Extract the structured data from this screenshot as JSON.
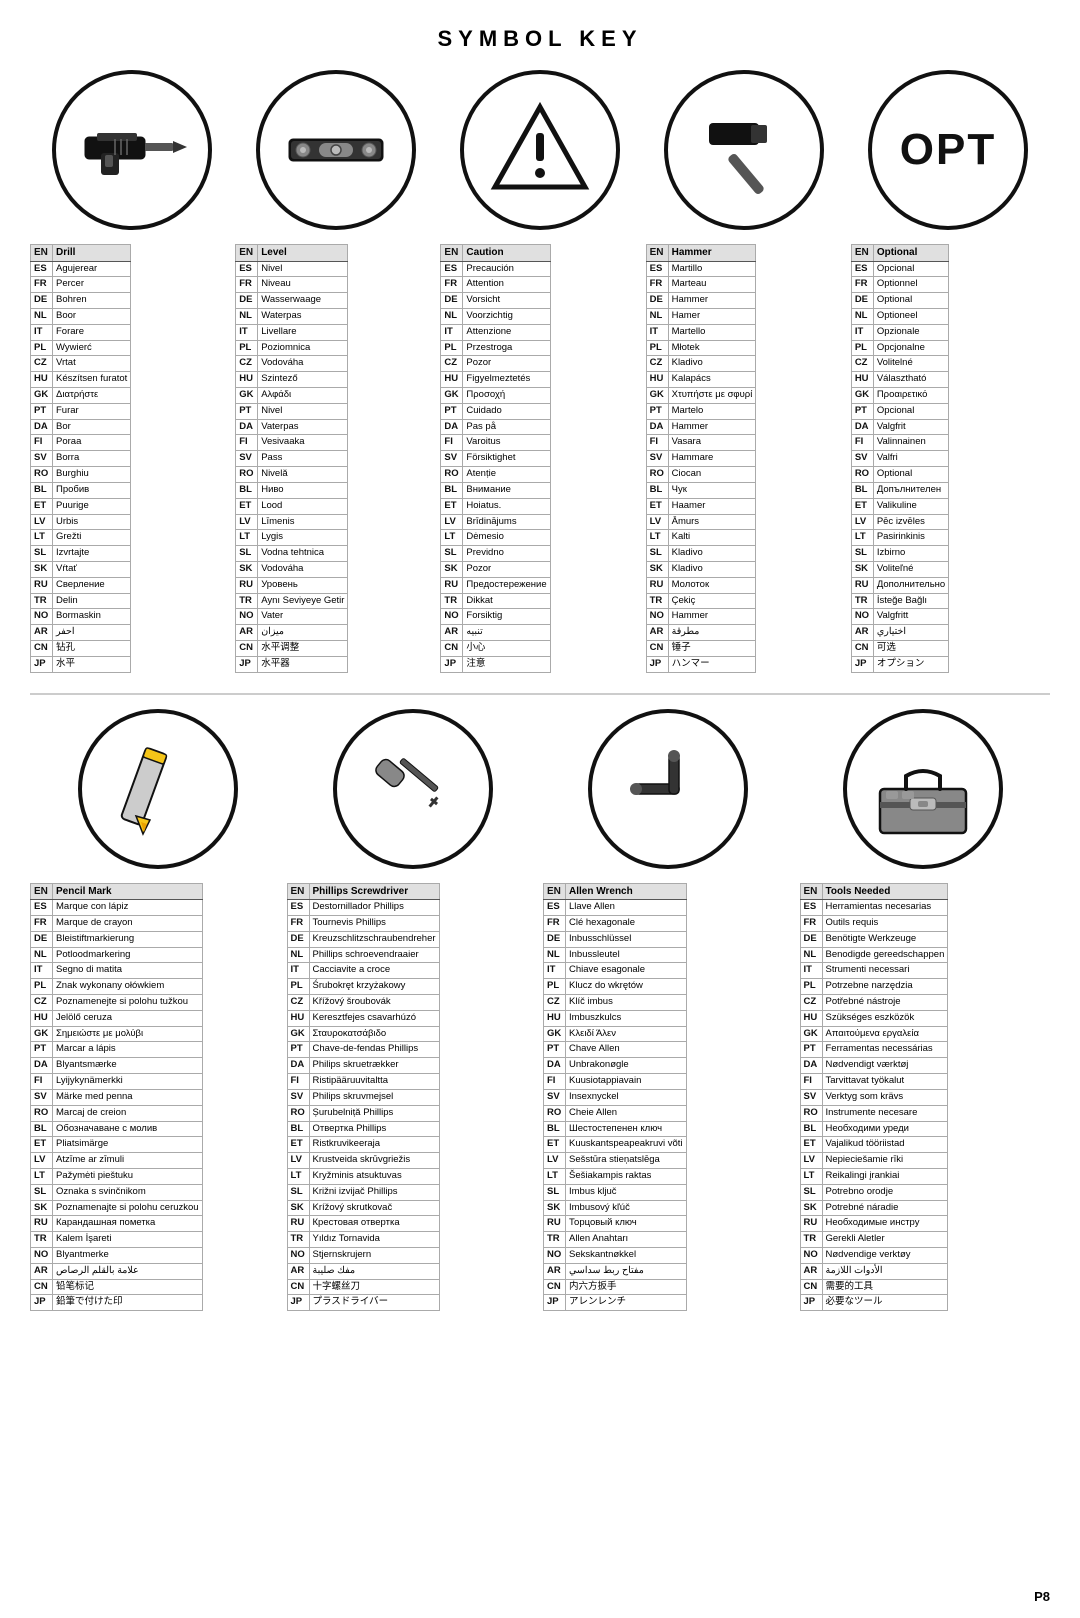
{
  "title": "SYMBOL KEY",
  "page": "P8",
  "icons_row1": [
    {
      "id": "drill",
      "label": "Drill icon"
    },
    {
      "id": "level",
      "label": "Level icon"
    },
    {
      "id": "caution",
      "label": "Caution icon"
    },
    {
      "id": "hammer",
      "label": "Hammer icon"
    },
    {
      "id": "optional",
      "label": "OPT icon"
    }
  ],
  "icons_row2": [
    {
      "id": "pencil",
      "label": "Pencil icon"
    },
    {
      "id": "phillips",
      "label": "Phillips screwdriver icon"
    },
    {
      "id": "allen",
      "label": "Allen wrench icon"
    },
    {
      "id": "toolbox",
      "label": "Toolbox icon"
    }
  ],
  "tables_row1": [
    {
      "header": [
        "EN",
        "Drill"
      ],
      "rows": [
        [
          "ES",
          "Agujerear"
        ],
        [
          "FR",
          "Percer"
        ],
        [
          "DE",
          "Bohren"
        ],
        [
          "NL",
          "Boor"
        ],
        [
          "IT",
          "Forare"
        ],
        [
          "PL",
          "Wywierć"
        ],
        [
          "CZ",
          "Vrtat"
        ],
        [
          "HU",
          "Készítsen furatot"
        ],
        [
          "GK",
          "Διατρήστε"
        ],
        [
          "PT",
          "Furar"
        ],
        [
          "DA",
          "Bor"
        ],
        [
          "FI",
          "Poraa"
        ],
        [
          "SV",
          "Borra"
        ],
        [
          "RO",
          "Burghiu"
        ],
        [
          "BL",
          "Пробив"
        ],
        [
          "ET",
          "Puurige"
        ],
        [
          "LV",
          "Urbis"
        ],
        [
          "LT",
          "Grežti"
        ],
        [
          "SL",
          "Izvrtajte"
        ],
        [
          "SK",
          "Vŕtať"
        ],
        [
          "RU",
          "Сверление"
        ],
        [
          "TR",
          "Delin"
        ],
        [
          "NO",
          "Bormaskin"
        ],
        [
          "AR",
          "احفر"
        ],
        [
          "CN",
          "钻孔"
        ],
        [
          "JP",
          "水平"
        ]
      ]
    },
    {
      "header": [
        "EN",
        "Level"
      ],
      "rows": [
        [
          "ES",
          "Nivel"
        ],
        [
          "FR",
          "Niveau"
        ],
        [
          "DE",
          "Wasserwaage"
        ],
        [
          "NL",
          "Waterpas"
        ],
        [
          "IT",
          "Livellare"
        ],
        [
          "PL",
          "Poziomnica"
        ],
        [
          "CZ",
          "Vodováha"
        ],
        [
          "HU",
          "Szintező"
        ],
        [
          "GK",
          "Αλφάδι"
        ],
        [
          "PT",
          "Nivel"
        ],
        [
          "DA",
          "Vaterpas"
        ],
        [
          "FI",
          "Vesivaaka"
        ],
        [
          "SV",
          "Pass"
        ],
        [
          "RO",
          "Nivelă"
        ],
        [
          "BL",
          "Ниво"
        ],
        [
          "ET",
          "Lood"
        ],
        [
          "LV",
          "Līmenis"
        ],
        [
          "LT",
          "Lygis"
        ],
        [
          "SL",
          "Vodna tehtnica"
        ],
        [
          "SK",
          "Vodováha"
        ],
        [
          "RU",
          "Уровень"
        ],
        [
          "TR",
          "Aynı Seviyeye Getir"
        ],
        [
          "NO",
          "Vater"
        ],
        [
          "AR",
          "ميزان"
        ],
        [
          "CN",
          "水平调整"
        ],
        [
          "JP",
          "水平器"
        ]
      ]
    },
    {
      "header": [
        "EN",
        "Caution"
      ],
      "rows": [
        [
          "ES",
          "Precaución"
        ],
        [
          "FR",
          "Attention"
        ],
        [
          "DE",
          "Vorsicht"
        ],
        [
          "NL",
          "Voorzichtig"
        ],
        [
          "IT",
          "Attenzione"
        ],
        [
          "PL",
          "Przestroga"
        ],
        [
          "CZ",
          "Pozor"
        ],
        [
          "HU",
          "Figyelmeztetés"
        ],
        [
          "GK",
          "Προσοχή"
        ],
        [
          "PT",
          "Cuidado"
        ],
        [
          "DA",
          "Pas på"
        ],
        [
          "FI",
          "Varoitus"
        ],
        [
          "SV",
          "Försiktighet"
        ],
        [
          "RO",
          "Atenție"
        ],
        [
          "BL",
          "Внимание"
        ],
        [
          "ET",
          "Hoiatus."
        ],
        [
          "LV",
          "Brīdinājums"
        ],
        [
          "LT",
          "Dėmesio"
        ],
        [
          "SL",
          "Previdno"
        ],
        [
          "SK",
          "Pozor"
        ],
        [
          "RU",
          "Предостережение"
        ],
        [
          "TR",
          "Dikkat"
        ],
        [
          "NO",
          "Forsiktig"
        ],
        [
          "AR",
          "تنبيه"
        ],
        [
          "CN",
          "小心"
        ],
        [
          "JP",
          "注意"
        ]
      ]
    },
    {
      "header": [
        "EN",
        "Hammer"
      ],
      "rows": [
        [
          "ES",
          "Martillo"
        ],
        [
          "FR",
          "Marteau"
        ],
        [
          "DE",
          "Hammer"
        ],
        [
          "NL",
          "Hamer"
        ],
        [
          "IT",
          "Martello"
        ],
        [
          "PL",
          "Młotek"
        ],
        [
          "CZ",
          "Kladivo"
        ],
        [
          "HU",
          "Kalapács"
        ],
        [
          "GK",
          "Χτυπήστε με σφυρί"
        ],
        [
          "PT",
          "Martelo"
        ],
        [
          "DA",
          "Hammer"
        ],
        [
          "FI",
          "Vasara"
        ],
        [
          "SV",
          "Hammare"
        ],
        [
          "RO",
          "Ciocan"
        ],
        [
          "BL",
          "Чук"
        ],
        [
          "ET",
          "Haamer"
        ],
        [
          "LV",
          "Āmurs"
        ],
        [
          "LT",
          "Kalti"
        ],
        [
          "SL",
          "Kladivo"
        ],
        [
          "SK",
          "Kladivo"
        ],
        [
          "RU",
          "Молоток"
        ],
        [
          "TR",
          "Çekiç"
        ],
        [
          "NO",
          "Hammer"
        ],
        [
          "AR",
          "مطرقة"
        ],
        [
          "CN",
          "锤子"
        ],
        [
          "JP",
          "ハンマー"
        ]
      ]
    },
    {
      "header": [
        "EN",
        "Optional"
      ],
      "rows": [
        [
          "ES",
          "Opcional"
        ],
        [
          "FR",
          "Optionnel"
        ],
        [
          "DE",
          "Optional"
        ],
        [
          "NL",
          "Optioneel"
        ],
        [
          "IT",
          "Opzionale"
        ],
        [
          "PL",
          "Opcjonalne"
        ],
        [
          "CZ",
          "Volitelné"
        ],
        [
          "HU",
          "Választható"
        ],
        [
          "GK",
          "Προαιρετικό"
        ],
        [
          "PT",
          "Opcional"
        ],
        [
          "DA",
          "Valgfrit"
        ],
        [
          "FI",
          "Valinnainen"
        ],
        [
          "SV",
          "Valfri"
        ],
        [
          "RO",
          "Optional"
        ],
        [
          "BL",
          "Допълнителен"
        ],
        [
          "ET",
          "Valikuline"
        ],
        [
          "LV",
          "Pēc izvēles"
        ],
        [
          "LT",
          "Pasirinkinis"
        ],
        [
          "SL",
          "Izbirno"
        ],
        [
          "SK",
          "Voliteľné"
        ],
        [
          "RU",
          "Дополнительно"
        ],
        [
          "TR",
          "İsteğe Bağlı"
        ],
        [
          "NO",
          "Valgfritt"
        ],
        [
          "AR",
          "اختياري"
        ],
        [
          "CN",
          "可选"
        ],
        [
          "JP",
          "オプション"
        ]
      ]
    }
  ],
  "tables_row2": [
    {
      "header": [
        "EN",
        "Pencil Mark"
      ],
      "rows": [
        [
          "ES",
          "Marque con lápiz"
        ],
        [
          "FR",
          "Marque de crayon"
        ],
        [
          "DE",
          "Bleistiftmarkierung"
        ],
        [
          "NL",
          "Potloodmarkering"
        ],
        [
          "IT",
          "Segno di matita"
        ],
        [
          "PL",
          "Znak wykonany ołówkiem"
        ],
        [
          "CZ",
          "Poznamenejte si polohu tužkou"
        ],
        [
          "HU",
          "Jelölő ceruza"
        ],
        [
          "GK",
          "Σημειώστε με μολύβι"
        ],
        [
          "PT",
          "Marcar a lápis"
        ],
        [
          "DA",
          "Blyantsmærke"
        ],
        [
          "FI",
          "Lyijykynämerkki"
        ],
        [
          "SV",
          "Märke med penna"
        ],
        [
          "RO",
          "Marcaj de creion"
        ],
        [
          "BL",
          "Обозначаване с молив"
        ],
        [
          "ET",
          "Pliatsimärge"
        ],
        [
          "LV",
          "Atzīme ar zīmuli"
        ],
        [
          "LT",
          "Pažymėti pieštuku"
        ],
        [
          "SL",
          "Oznaka s svinčnikom"
        ],
        [
          "SK",
          "Poznamenajte si polohu ceruzkou"
        ],
        [
          "RU",
          "Карандашная пометка"
        ],
        [
          "TR",
          "Kalem İşareti"
        ],
        [
          "NO",
          "Blyantmerke"
        ],
        [
          "AR",
          "علامة بالقلم الرصاص"
        ],
        [
          "CN",
          "铅笔标记"
        ],
        [
          "JP",
          "鉛筆で付けた印"
        ]
      ]
    },
    {
      "header": [
        "EN",
        "Phillips Screwdriver"
      ],
      "rows": [
        [
          "ES",
          "Destornillador Phillips"
        ],
        [
          "FR",
          "Tournevis Phillips"
        ],
        [
          "DE",
          "Kreuzschlitzschraubendreher"
        ],
        [
          "NL",
          "Phillips schroevendraaier"
        ],
        [
          "IT",
          "Cacciavite a croce"
        ],
        [
          "PL",
          "Śrubokręt krzyżakowy"
        ],
        [
          "CZ",
          "Křížový šroubovák"
        ],
        [
          "HU",
          "Keresztfejes csavarhúzó"
        ],
        [
          "GK",
          "Σταυροκατσάβιδο"
        ],
        [
          "PT",
          "Chave-de-fendas Phillips"
        ],
        [
          "DA",
          "Philips skruetrækker"
        ],
        [
          "FI",
          "Ristipääruuvitaltta"
        ],
        [
          "SV",
          "Philips skruvmejsel"
        ],
        [
          "RO",
          "Șurubelniță Phillips"
        ],
        [
          "BL",
          "Отвертка Phillips"
        ],
        [
          "ET",
          "Ristkruvikeeraja"
        ],
        [
          "LV",
          "Krustveida skrūvgriežis"
        ],
        [
          "LT",
          "Kryžminis atsuktuvas"
        ],
        [
          "SL",
          "Križni izvijač Phillips"
        ],
        [
          "SK",
          "Krížový skrutkovač"
        ],
        [
          "RU",
          "Крестовая отвертка"
        ],
        [
          "TR",
          "Yıldız Tornavida"
        ],
        [
          "NO",
          "Stjernskrujern"
        ],
        [
          "AR",
          "مفك صليبة"
        ],
        [
          "CN",
          "十字螺丝刀"
        ],
        [
          "JP",
          "プラスドライバー"
        ]
      ]
    },
    {
      "header": [
        "EN",
        "Allen Wrench"
      ],
      "rows": [
        [
          "ES",
          "Llave Allen"
        ],
        [
          "FR",
          "Clé hexagonale"
        ],
        [
          "DE",
          "Inbusschlüssel"
        ],
        [
          "NL",
          "Inbussleutel"
        ],
        [
          "IT",
          "Chiave esagonale"
        ],
        [
          "PL",
          "Klucz do wkrętów"
        ],
        [
          "CZ",
          "Klíč imbus"
        ],
        [
          "HU",
          "Imbuszkulcs"
        ],
        [
          "GK",
          "Κλειδί Άλεν"
        ],
        [
          "PT",
          "Chave Allen"
        ],
        [
          "DA",
          "Unbrakonøgle"
        ],
        [
          "FI",
          "Kuusiotappiavain"
        ],
        [
          "SV",
          "Insexnyckel"
        ],
        [
          "RO",
          "Cheie Allen"
        ],
        [
          "BL",
          "Шестостепенен ключ"
        ],
        [
          "ET",
          "Kuuskantspeapeakruvi võti"
        ],
        [
          "LV",
          "Sešstūra stieņatslēga"
        ],
        [
          "LT",
          "Šešiakampis raktas"
        ],
        [
          "SL",
          "Imbus ključ"
        ],
        [
          "SK",
          "Imbusový kľúč"
        ],
        [
          "RU",
          "Торцовый ключ"
        ],
        [
          "TR",
          "Allen Anahtarı"
        ],
        [
          "NO",
          "Sekskantnøkkel"
        ],
        [
          "AR",
          "مفتاح ربط سداسي"
        ],
        [
          "CN",
          "内六方扳手"
        ],
        [
          "JP",
          "アレンレンチ"
        ]
      ]
    },
    {
      "header": [
        "EN",
        "Tools Needed"
      ],
      "rows": [
        [
          "ES",
          "Herramientas necesarias"
        ],
        [
          "FR",
          "Outils requis"
        ],
        [
          "DE",
          "Benötigte Werkzeuge"
        ],
        [
          "NL",
          "Benodigde gereedschappen"
        ],
        [
          "IT",
          "Strumenti necessari"
        ],
        [
          "PL",
          "Potrzebne narzędzia"
        ],
        [
          "CZ",
          "Potřebné nástroje"
        ],
        [
          "HU",
          "Szükséges eszközök"
        ],
        [
          "GK",
          "Απαιτούμενα εργαλεία"
        ],
        [
          "PT",
          "Ferramentas necessárias"
        ],
        [
          "DA",
          "Nødvendigt værktøj"
        ],
        [
          "FI",
          "Tarvittavat työkalut"
        ],
        [
          "SV",
          "Verktyg som krävs"
        ],
        [
          "RO",
          "Instrumente necesare"
        ],
        [
          "BL",
          "Необходими уреди"
        ],
        [
          "ET",
          "Vajalikud tööriistad"
        ],
        [
          "LV",
          "Nepieciešamie rīki"
        ],
        [
          "LT",
          "Reikalingi įrankiai"
        ],
        [
          "SL",
          "Potrebno orodje"
        ],
        [
          "SK",
          "Potrebné náradie"
        ],
        [
          "RU",
          "Необходимые инстру"
        ],
        [
          "TR",
          "Gerekli Aletler"
        ],
        [
          "NO",
          "Nødvendige verktøy"
        ],
        [
          "AR",
          "الأدوات اللازمة"
        ],
        [
          "CN",
          "需要的工具"
        ],
        [
          "JP",
          "必要なツール"
        ]
      ]
    }
  ]
}
